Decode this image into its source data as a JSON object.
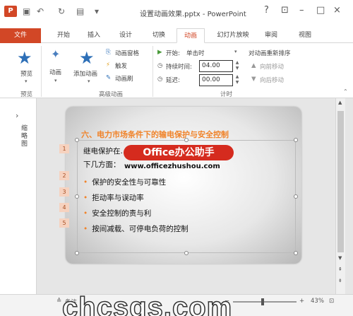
{
  "titlebar": {
    "logo": "P",
    "title": "设置动画效果.pptx - PowerPoint",
    "help": "?",
    "restore": "⊡",
    "minimize": "–",
    "maximize": "□",
    "close": "×"
  },
  "tabs": {
    "file": "文件",
    "home": "开始",
    "insert": "插入",
    "design": "设计",
    "transitions": "切换",
    "animations": "动画",
    "slideshow": "幻灯片放映",
    "review": "审阅",
    "view": "视图"
  },
  "ribbon": {
    "preview": {
      "label": "预览",
      "group": "预览"
    },
    "animation": {
      "label": "动画"
    },
    "add_animation": {
      "label": "添加动画"
    },
    "animation_pane": "动画窗格",
    "trigger": "触发",
    "animation_painter": "动画刷",
    "advanced_group": "高级动画",
    "start_label": "开始:",
    "start_value": "单击时",
    "duration_label": "持续时间:",
    "duration_value": "04.00",
    "delay_label": "延迟:",
    "delay_value": "00.00",
    "reorder_title": "对动画重新排序",
    "move_earlier": "向前移动",
    "move_later": "向后移动",
    "timing_group": "计时"
  },
  "left_pane": {
    "arrow": "›",
    "label": "缩略图"
  },
  "slide": {
    "title": "六、电力市场条件下的输电保护与安全控制",
    "body_line1": "继电保护在…………中的作用，主要在于以",
    "body_line2": "下几方面：",
    "bullets": [
      "保护的安全性与可靠性",
      "拒动率与误动率",
      "安全控制的责与利",
      "按间减载、可停电负荷的控制"
    ],
    "tags": [
      "1",
      "2",
      "3",
      "4",
      "5"
    ]
  },
  "watermark": {
    "badge": "Office办公助手",
    "url": "www.officezhushou.com",
    "bottom": "chcsgs.com"
  },
  "statusbar": {
    "notes": "备注",
    "zoom": "43%"
  }
}
